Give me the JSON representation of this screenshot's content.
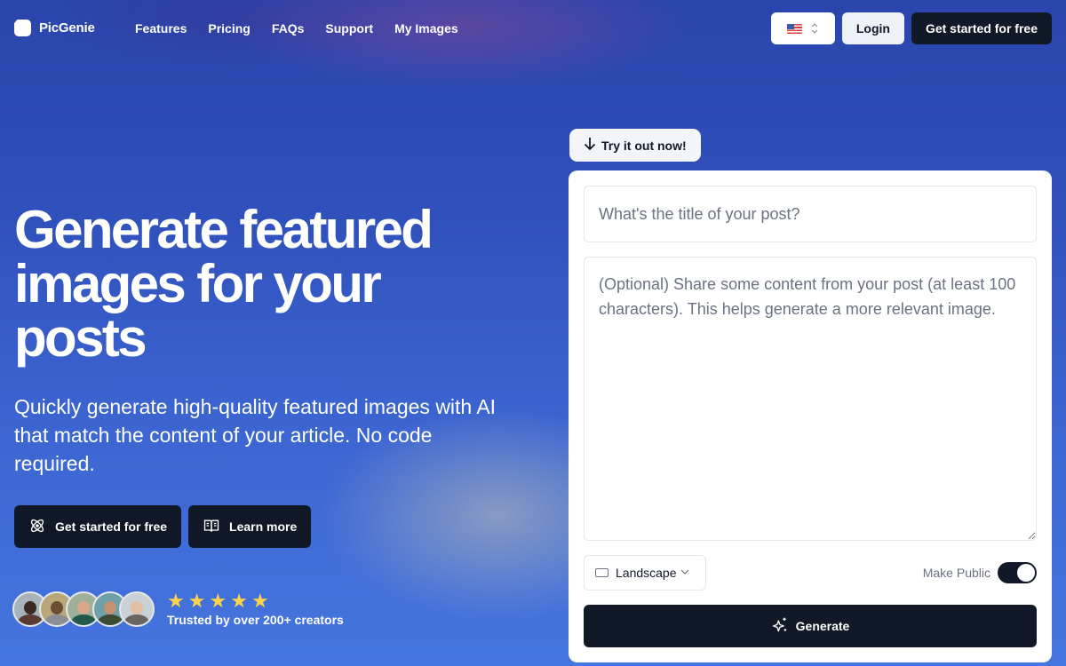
{
  "nav": {
    "brand": "PicGenie",
    "links": [
      {
        "label": "Features"
      },
      {
        "label": "Pricing"
      },
      {
        "label": "FAQs"
      },
      {
        "label": "Support"
      },
      {
        "label": "My Images"
      }
    ],
    "language": {
      "selected": "en-US",
      "icon": "us-flag-icon"
    },
    "login_label": "Login",
    "cta_label": "Get started for free"
  },
  "hero": {
    "title": "Generate featured images for your posts",
    "subtitle": "Quickly generate high-quality featured images with AI that match the content of your article. No code required.",
    "primary_cta": {
      "label": "Get started for free",
      "icon": "atom-icon"
    },
    "secondary_cta": {
      "label": "Learn more",
      "icon": "book-open-icon"
    },
    "social_proof": {
      "avatar_count": 5,
      "rating": 5,
      "rating_max": 5,
      "text": "Trusted by over 200+ creators"
    }
  },
  "generator": {
    "badge": {
      "label": "Try it out now!",
      "icon": "arrow-down-icon"
    },
    "title_input": {
      "value": "",
      "placeholder": "What's the title of your post?"
    },
    "content_input": {
      "value": "",
      "placeholder": "(Optional) Share some content from your post (at least 100 characters). This helps generate a more relevant image."
    },
    "orientation": {
      "selected": "Landscape"
    },
    "make_public": {
      "label": "Make Public",
      "checked": true
    },
    "generate_label": "Generate"
  },
  "colors": {
    "dark": "#111827",
    "star": "#fcd34d",
    "placeholder": "#6b7280",
    "bg_top": "#2a45ad",
    "bg_bottom": "#4575de"
  }
}
